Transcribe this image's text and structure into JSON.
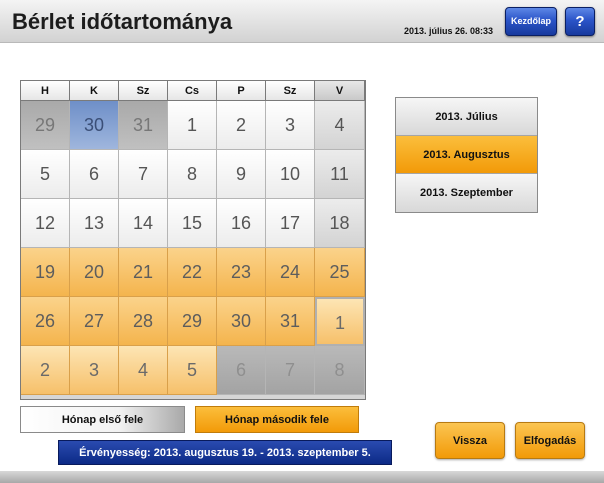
{
  "header": {
    "title": "Bérlet időtartománya",
    "datetime": "2013. július 26.  08:33",
    "home_label": "Kezdőlap",
    "help_label": "?"
  },
  "calendar": {
    "weekdays": [
      "H",
      "K",
      "Sz",
      "Cs",
      "P",
      "Sz",
      "V"
    ],
    "rows": [
      [
        {
          "day": "29",
          "state": "prev"
        },
        {
          "day": "30",
          "state": "today"
        },
        {
          "day": "31",
          "state": "prev"
        },
        {
          "day": "1",
          "state": "normal"
        },
        {
          "day": "2",
          "state": "normal"
        },
        {
          "day": "3",
          "state": "normal"
        },
        {
          "day": "4",
          "state": "normal"
        }
      ],
      [
        {
          "day": "5",
          "state": "normal"
        },
        {
          "day": "6",
          "state": "normal"
        },
        {
          "day": "7",
          "state": "normal"
        },
        {
          "day": "8",
          "state": "normal"
        },
        {
          "day": "9",
          "state": "normal"
        },
        {
          "day": "10",
          "state": "normal"
        },
        {
          "day": "11",
          "state": "normal"
        }
      ],
      [
        {
          "day": "12",
          "state": "normal"
        },
        {
          "day": "13",
          "state": "normal"
        },
        {
          "day": "14",
          "state": "normal"
        },
        {
          "day": "15",
          "state": "normal"
        },
        {
          "day": "16",
          "state": "normal"
        },
        {
          "day": "17",
          "state": "normal"
        },
        {
          "day": "18",
          "state": "normal"
        }
      ],
      [
        {
          "day": "19",
          "state": "sel"
        },
        {
          "day": "20",
          "state": "sel"
        },
        {
          "day": "21",
          "state": "sel"
        },
        {
          "day": "22",
          "state": "sel"
        },
        {
          "day": "23",
          "state": "sel"
        },
        {
          "day": "24",
          "state": "sel"
        },
        {
          "day": "25",
          "state": "sel"
        }
      ],
      [
        {
          "day": "26",
          "state": "sel"
        },
        {
          "day": "27",
          "state": "sel"
        },
        {
          "day": "28",
          "state": "sel"
        },
        {
          "day": "29",
          "state": "sel"
        },
        {
          "day": "30",
          "state": "sel"
        },
        {
          "day": "31",
          "state": "sel"
        },
        {
          "day": "1",
          "state": "sel-next-end"
        }
      ],
      [
        {
          "day": "2",
          "state": "sel-next"
        },
        {
          "day": "3",
          "state": "sel-next"
        },
        {
          "day": "4",
          "state": "sel-next"
        },
        {
          "day": "5",
          "state": "sel-next"
        },
        {
          "day": "6",
          "state": "gray"
        },
        {
          "day": "7",
          "state": "gray"
        },
        {
          "day": "8",
          "state": "gray"
        }
      ]
    ]
  },
  "months": [
    {
      "label": "2013. Július",
      "active": false
    },
    {
      "label": "2013. Augusztus",
      "active": true
    },
    {
      "label": "2013. Szeptember",
      "active": false
    }
  ],
  "period": {
    "first_half_label": "Hónap első fele",
    "second_half_label": "Hónap második fele"
  },
  "validity_text": "Érvényesség: 2013. augusztus 19. - 2013. szeptember 5.",
  "actions": {
    "back_label": "Vissza",
    "accept_label": "Elfogadás"
  },
  "colors": {
    "accent_orange": "#f29a08",
    "accent_blue": "#1c3fa5",
    "today_blue": "#7f9dd0"
  }
}
